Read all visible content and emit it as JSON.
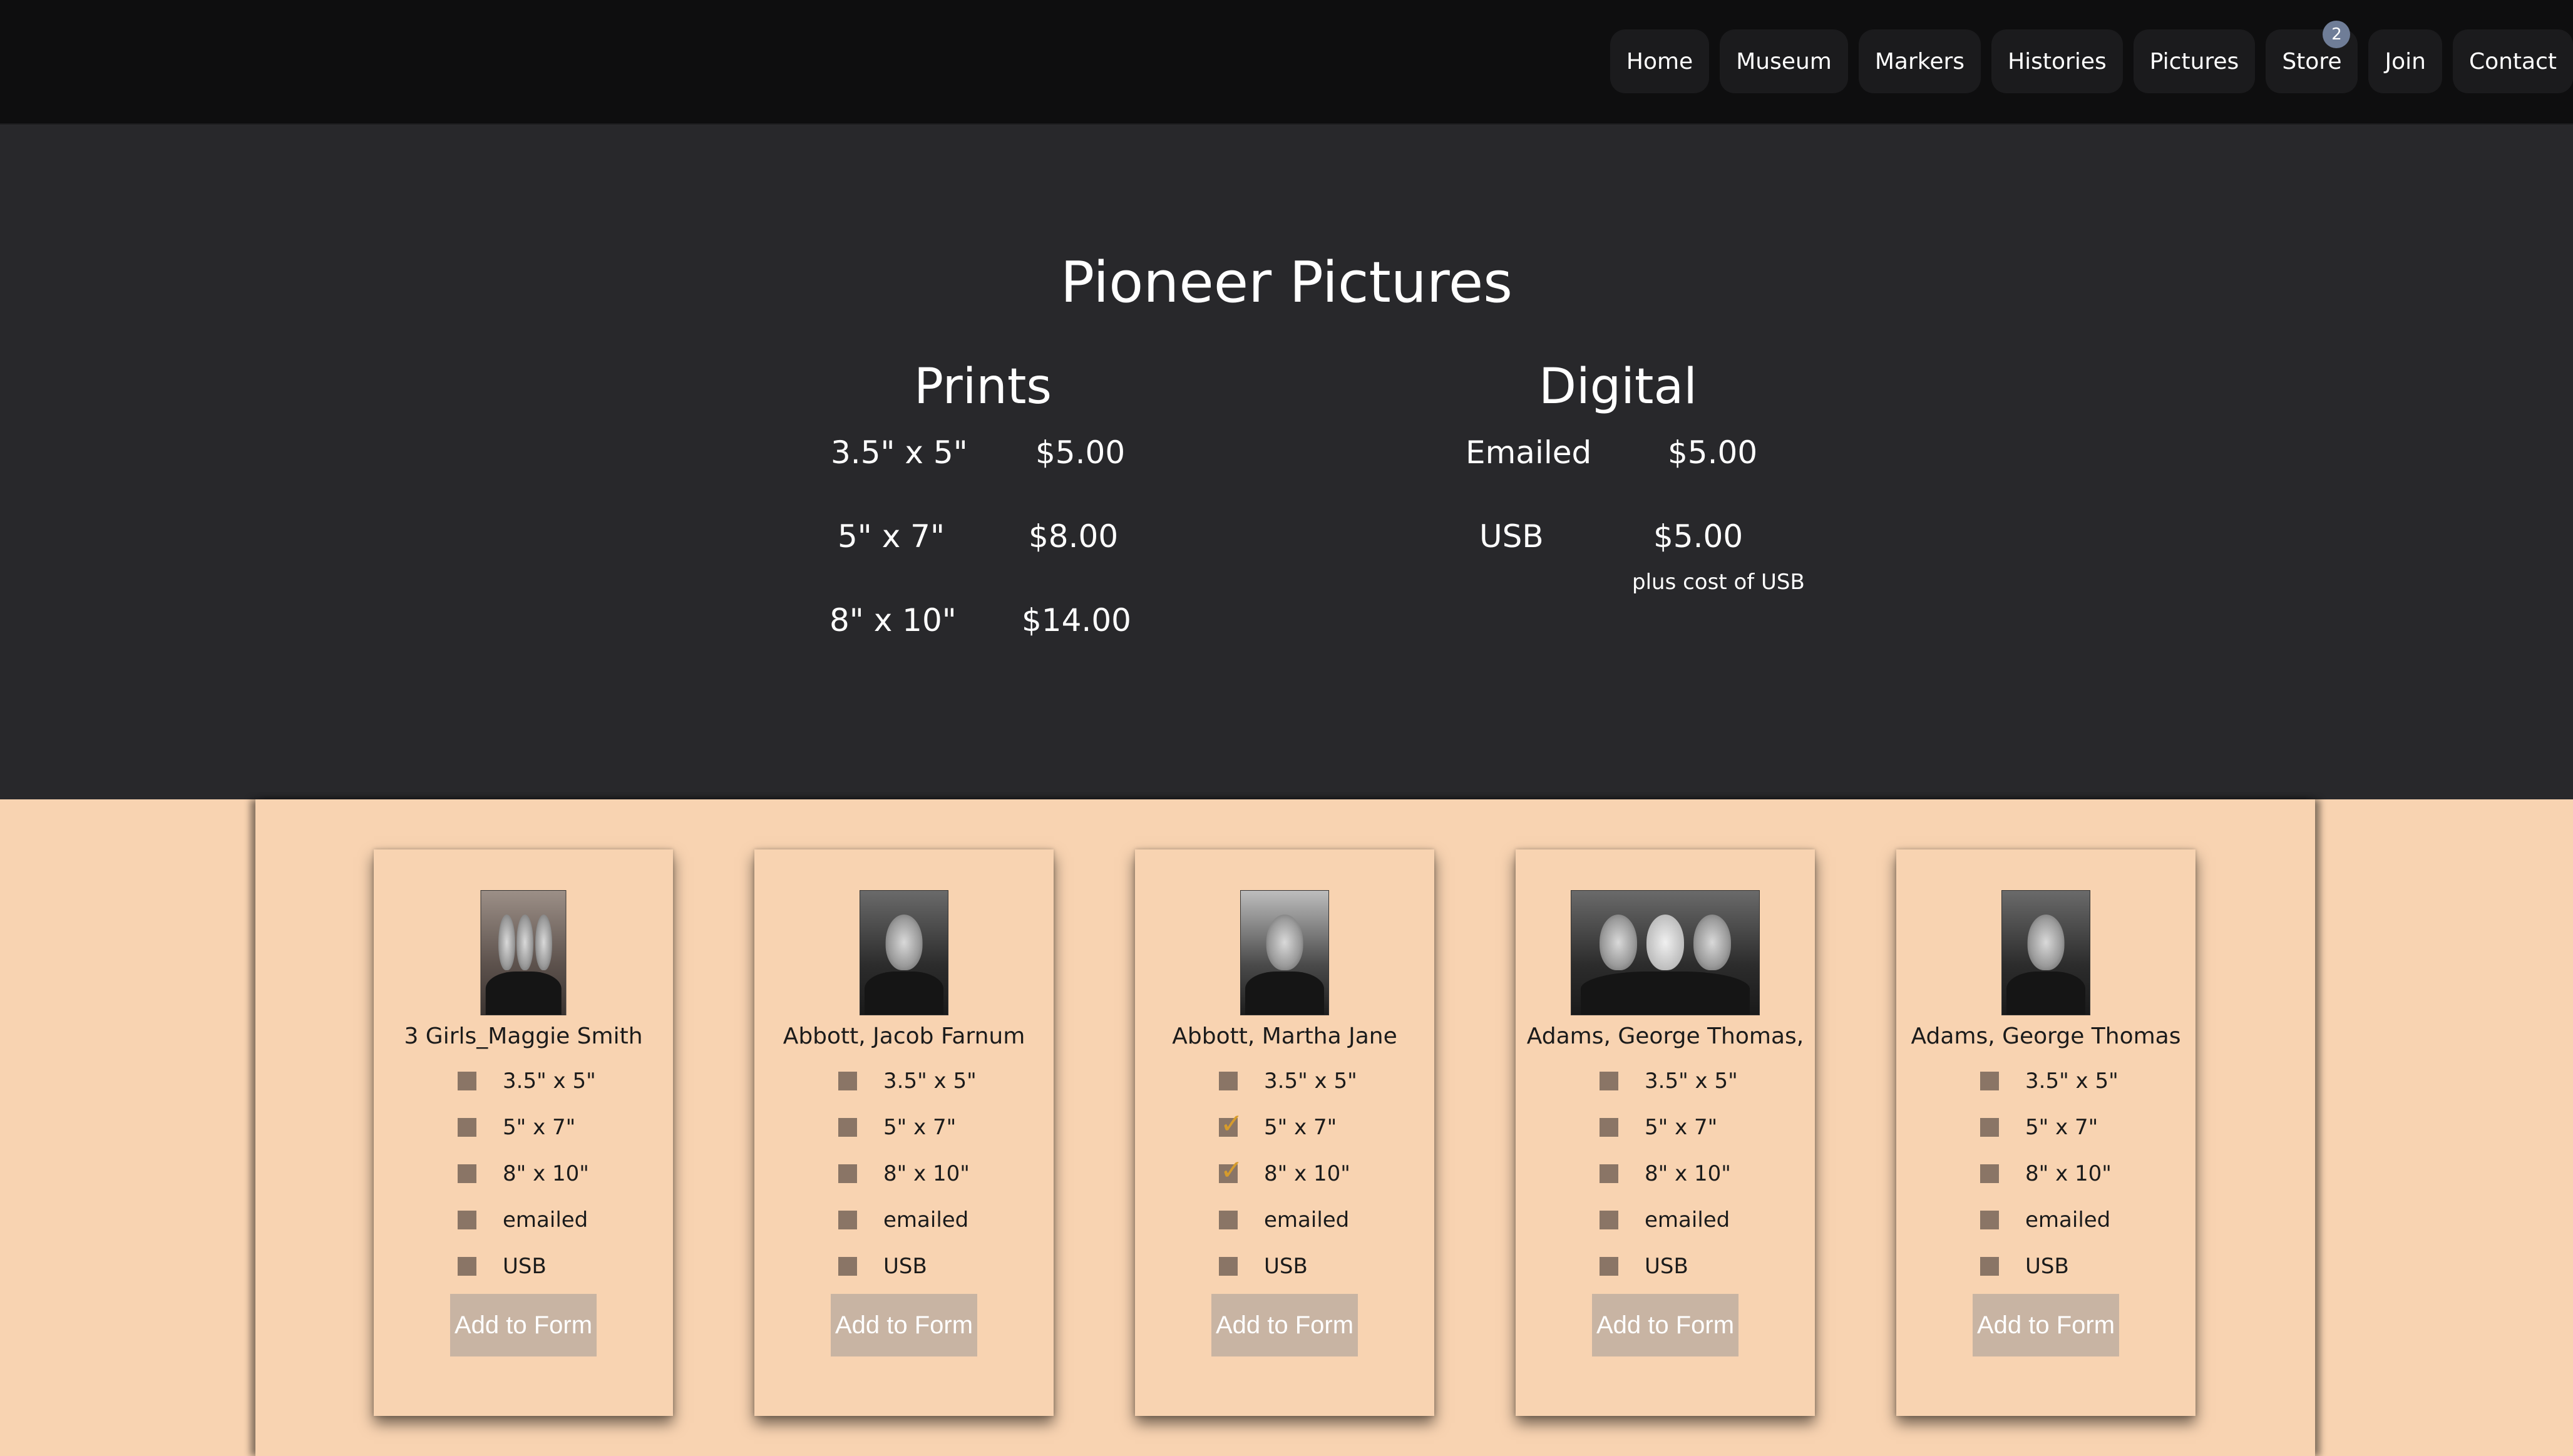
{
  "nav": {
    "items": [
      "Home",
      "Museum",
      "Markers",
      "Histories",
      "Pictures",
      "Store",
      "Join",
      "Contact"
    ],
    "store_badge": "2"
  },
  "hero": {
    "title": "Pioneer Pictures",
    "prints": {
      "title": "Prints",
      "rows": [
        {
          "size": "3.5\" x 5\"",
          "price": "$5.00"
        },
        {
          "size": "5\" x 7\"",
          "price": "$8.00"
        },
        {
          "size": "8\" x 10\"",
          "price": "$14.00"
        }
      ]
    },
    "digital": {
      "title": "Digital",
      "rows": [
        {
          "type": "Emailed",
          "price": "$5.00"
        },
        {
          "type": "USB",
          "price": "$5.00"
        }
      ],
      "usb_note": "plus cost of USB"
    }
  },
  "options": [
    "3.5\" x 5\"",
    "5\" x 7\"",
    "8\" x 10\"",
    "emailed",
    "USB"
  ],
  "add_button_label": "Add to Form",
  "cards": [
    {
      "name": "3 Girls_Maggie Smith",
      "checked": [
        false,
        false,
        false,
        false,
        false
      ]
    },
    {
      "name": "Abbott, Jacob Farnum",
      "checked": [
        false,
        false,
        false,
        false,
        false
      ]
    },
    {
      "name": "Abbott, Martha Jane",
      "checked": [
        false,
        true,
        true,
        false,
        false
      ]
    },
    {
      "name": "Adams, George Thomas,",
      "checked": [
        false,
        false,
        false,
        false,
        false
      ]
    },
    {
      "name": "Adams, George Thomas",
      "checked": [
        false,
        false,
        false,
        false,
        false
      ]
    }
  ]
}
